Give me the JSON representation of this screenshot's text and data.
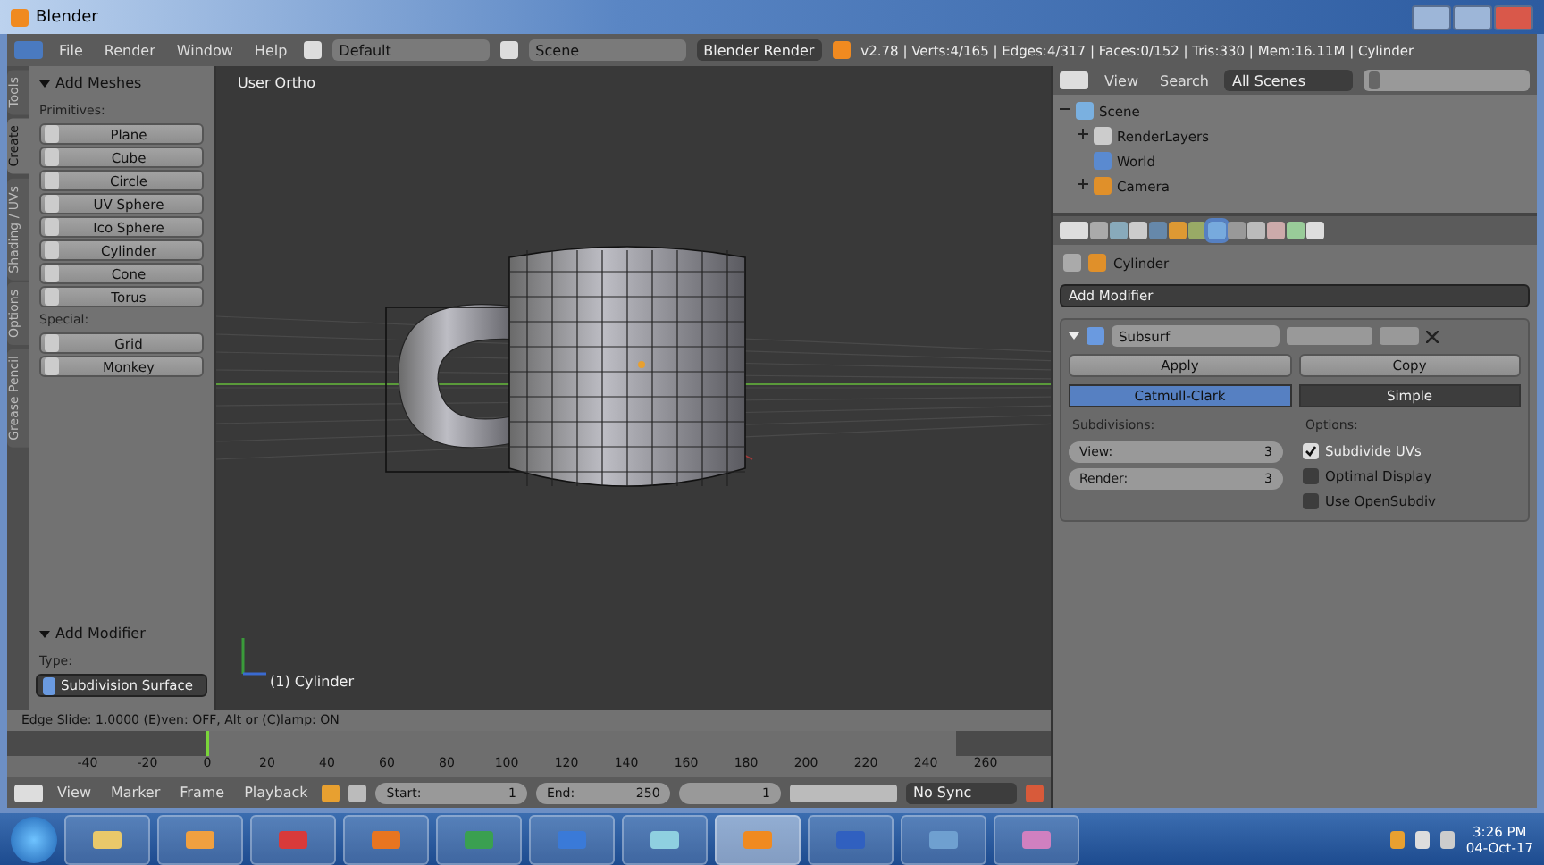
{
  "window": {
    "title": "Blender"
  },
  "menu_bar": {
    "menus": [
      "File",
      "Render",
      "Window",
      "Help"
    ],
    "screen_layout": "Default",
    "scene": "Scene",
    "render_engine": "Blender Render",
    "stats": "v2.78 | Verts:4/165 | Edges:4/317 | Faces:0/152 | Tris:330 | Mem:16.11M | Cylinder"
  },
  "tool_shelf": {
    "tabs": [
      {
        "label": "Tools",
        "selected": false
      },
      {
        "label": "Create",
        "selected": true
      },
      {
        "label": "Shading / UVs",
        "selected": false
      },
      {
        "label": "Options",
        "selected": false
      },
      {
        "label": "Grease Pencil",
        "selected": false
      }
    ],
    "panel_title": "Add Meshes",
    "primitives_label": "Primitives:",
    "primitives": [
      "Plane",
      "Cube",
      "Circle",
      "UV Sphere",
      "Ico Sphere",
      "Cylinder",
      "Cone",
      "Torus"
    ],
    "special_label": "Special:",
    "special": [
      "Grid",
      "Monkey"
    ],
    "operator_panel": {
      "title": "Add Modifier",
      "type_label": "Type:",
      "type": "Subdivision Surface"
    }
  },
  "viewport": {
    "view_name": "User Ortho",
    "object_label": "(1) Cylinder"
  },
  "status": "Edge Slide: 1.0000 (E)ven: OFF, Alt or (C)lamp: ON",
  "timeline": {
    "ticks": [
      "-40",
      "-20",
      "0",
      "20",
      "40",
      "60",
      "80",
      "100",
      "120",
      "140",
      "160",
      "180",
      "200",
      "220",
      "240",
      "260"
    ],
    "menus": [
      "View",
      "Marker",
      "Frame",
      "Playback"
    ],
    "start_label": "Start:",
    "start": "1",
    "end_label": "End:",
    "end": "250",
    "current": "1",
    "sync": "No Sync"
  },
  "outliner": {
    "menus": [
      "View",
      "Search"
    ],
    "filter": "All Scenes",
    "tree": [
      {
        "label": "Scene",
        "expanded": true,
        "children": [
          {
            "label": "RenderLayers",
            "expanded": false
          },
          {
            "label": "World"
          },
          {
            "label": "Camera",
            "expanded": false
          }
        ]
      }
    ]
  },
  "properties": {
    "tabs": [
      {
        "selected": false
      },
      {
        "selected": false
      },
      {
        "selected": false
      },
      {
        "selected": false
      },
      {
        "selected": false
      },
      {
        "selected": false
      },
      {
        "selected": true
      },
      {
        "selected": false
      },
      {
        "selected": false
      },
      {
        "selected": false
      },
      {
        "selected": false
      },
      {
        "selected": false
      }
    ],
    "object": "Cylinder",
    "add_modifier": "Add Modifier",
    "modifier": {
      "name": "Subsurf",
      "expanded": true,
      "buttons": [
        "Apply",
        "Copy"
      ],
      "modes": [
        {
          "label": "Catmull-Clark",
          "selected": true
        },
        {
          "label": "Simple",
          "selected": false
        }
      ],
      "subdivisions_label": "Subdivisions:",
      "fields": [
        {
          "label": "View:",
          "value": "3"
        },
        {
          "label": "Render:",
          "value": "3"
        }
      ],
      "options_label": "Options:",
      "options": [
        {
          "label": "Subdivide UVs",
          "checked": true
        },
        {
          "label": "Optimal Display",
          "checked": false
        },
        {
          "label": "Use OpenSubdiv",
          "checked": false
        }
      ]
    }
  },
  "taskbar": {
    "apps": [
      {
        "selected": false
      },
      {
        "selected": false
      },
      {
        "selected": false
      },
      {
        "selected": false
      },
      {
        "selected": false
      },
      {
        "selected": false
      },
      {
        "selected": false
      },
      {
        "selected": true
      },
      {
        "selected": false
      },
      {
        "selected": false
      },
      {
        "selected": false
      }
    ],
    "time": "3:26 PM",
    "date": "04-Oct-17"
  }
}
